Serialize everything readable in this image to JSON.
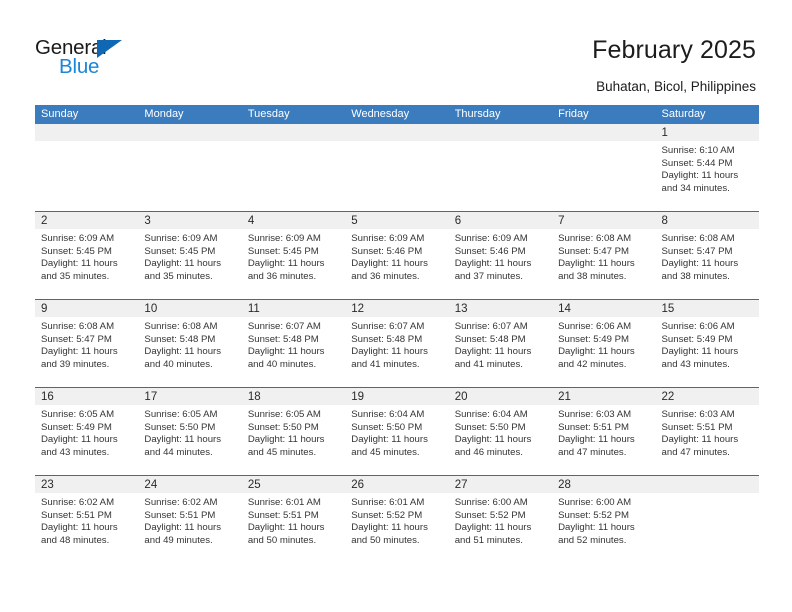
{
  "logo": {
    "word_one": "General",
    "word_two": "Blue",
    "triangle_color": "#1068b5",
    "blue_color": "#1a86d8"
  },
  "header": {
    "title": "February 2025",
    "subtitle": "Buhatan, Bicol, Philippines"
  },
  "theme": {
    "header_bg": "#3a7cbe",
    "header_text": "#ffffff",
    "row_divider": "#2f6fac",
    "daynum_band": "#f0f0f0",
    "body_text": "#343434"
  },
  "weekdays": [
    "Sunday",
    "Monday",
    "Tuesday",
    "Wednesday",
    "Thursday",
    "Friday",
    "Saturday"
  ],
  "weeks": [
    [
      {
        "day": "",
        "sunrise": "",
        "sunset": "",
        "daylight": ""
      },
      {
        "day": "",
        "sunrise": "",
        "sunset": "",
        "daylight": ""
      },
      {
        "day": "",
        "sunrise": "",
        "sunset": "",
        "daylight": ""
      },
      {
        "day": "",
        "sunrise": "",
        "sunset": "",
        "daylight": ""
      },
      {
        "day": "",
        "sunrise": "",
        "sunset": "",
        "daylight": ""
      },
      {
        "day": "",
        "sunrise": "",
        "sunset": "",
        "daylight": ""
      },
      {
        "day": "1",
        "sunrise": "Sunrise: 6:10 AM",
        "sunset": "Sunset: 5:44 PM",
        "daylight": "Daylight: 11 hours and 34 minutes."
      }
    ],
    [
      {
        "day": "2",
        "sunrise": "Sunrise: 6:09 AM",
        "sunset": "Sunset: 5:45 PM",
        "daylight": "Daylight: 11 hours and 35 minutes."
      },
      {
        "day": "3",
        "sunrise": "Sunrise: 6:09 AM",
        "sunset": "Sunset: 5:45 PM",
        "daylight": "Daylight: 11 hours and 35 minutes."
      },
      {
        "day": "4",
        "sunrise": "Sunrise: 6:09 AM",
        "sunset": "Sunset: 5:45 PM",
        "daylight": "Daylight: 11 hours and 36 minutes."
      },
      {
        "day": "5",
        "sunrise": "Sunrise: 6:09 AM",
        "sunset": "Sunset: 5:46 PM",
        "daylight": "Daylight: 11 hours and 36 minutes."
      },
      {
        "day": "6",
        "sunrise": "Sunrise: 6:09 AM",
        "sunset": "Sunset: 5:46 PM",
        "daylight": "Daylight: 11 hours and 37 minutes."
      },
      {
        "day": "7",
        "sunrise": "Sunrise: 6:08 AM",
        "sunset": "Sunset: 5:47 PM",
        "daylight": "Daylight: 11 hours and 38 minutes."
      },
      {
        "day": "8",
        "sunrise": "Sunrise: 6:08 AM",
        "sunset": "Sunset: 5:47 PM",
        "daylight": "Daylight: 11 hours and 38 minutes."
      }
    ],
    [
      {
        "day": "9",
        "sunrise": "Sunrise: 6:08 AM",
        "sunset": "Sunset: 5:47 PM",
        "daylight": "Daylight: 11 hours and 39 minutes."
      },
      {
        "day": "10",
        "sunrise": "Sunrise: 6:08 AM",
        "sunset": "Sunset: 5:48 PM",
        "daylight": "Daylight: 11 hours and 40 minutes."
      },
      {
        "day": "11",
        "sunrise": "Sunrise: 6:07 AM",
        "sunset": "Sunset: 5:48 PM",
        "daylight": "Daylight: 11 hours and 40 minutes."
      },
      {
        "day": "12",
        "sunrise": "Sunrise: 6:07 AM",
        "sunset": "Sunset: 5:48 PM",
        "daylight": "Daylight: 11 hours and 41 minutes."
      },
      {
        "day": "13",
        "sunrise": "Sunrise: 6:07 AM",
        "sunset": "Sunset: 5:48 PM",
        "daylight": "Daylight: 11 hours and 41 minutes."
      },
      {
        "day": "14",
        "sunrise": "Sunrise: 6:06 AM",
        "sunset": "Sunset: 5:49 PM",
        "daylight": "Daylight: 11 hours and 42 minutes."
      },
      {
        "day": "15",
        "sunrise": "Sunrise: 6:06 AM",
        "sunset": "Sunset: 5:49 PM",
        "daylight": "Daylight: 11 hours and 43 minutes."
      }
    ],
    [
      {
        "day": "16",
        "sunrise": "Sunrise: 6:05 AM",
        "sunset": "Sunset: 5:49 PM",
        "daylight": "Daylight: 11 hours and 43 minutes."
      },
      {
        "day": "17",
        "sunrise": "Sunrise: 6:05 AM",
        "sunset": "Sunset: 5:50 PM",
        "daylight": "Daylight: 11 hours and 44 minutes."
      },
      {
        "day": "18",
        "sunrise": "Sunrise: 6:05 AM",
        "sunset": "Sunset: 5:50 PM",
        "daylight": "Daylight: 11 hours and 45 minutes."
      },
      {
        "day": "19",
        "sunrise": "Sunrise: 6:04 AM",
        "sunset": "Sunset: 5:50 PM",
        "daylight": "Daylight: 11 hours and 45 minutes."
      },
      {
        "day": "20",
        "sunrise": "Sunrise: 6:04 AM",
        "sunset": "Sunset: 5:50 PM",
        "daylight": "Daylight: 11 hours and 46 minutes."
      },
      {
        "day": "21",
        "sunrise": "Sunrise: 6:03 AM",
        "sunset": "Sunset: 5:51 PM",
        "daylight": "Daylight: 11 hours and 47 minutes."
      },
      {
        "day": "22",
        "sunrise": "Sunrise: 6:03 AM",
        "sunset": "Sunset: 5:51 PM",
        "daylight": "Daylight: 11 hours and 47 minutes."
      }
    ],
    [
      {
        "day": "23",
        "sunrise": "Sunrise: 6:02 AM",
        "sunset": "Sunset: 5:51 PM",
        "daylight": "Daylight: 11 hours and 48 minutes."
      },
      {
        "day": "24",
        "sunrise": "Sunrise: 6:02 AM",
        "sunset": "Sunset: 5:51 PM",
        "daylight": "Daylight: 11 hours and 49 minutes."
      },
      {
        "day": "25",
        "sunrise": "Sunrise: 6:01 AM",
        "sunset": "Sunset: 5:51 PM",
        "daylight": "Daylight: 11 hours and 50 minutes."
      },
      {
        "day": "26",
        "sunrise": "Sunrise: 6:01 AM",
        "sunset": "Sunset: 5:52 PM",
        "daylight": "Daylight: 11 hours and 50 minutes."
      },
      {
        "day": "27",
        "sunrise": "Sunrise: 6:00 AM",
        "sunset": "Sunset: 5:52 PM",
        "daylight": "Daylight: 11 hours and 51 minutes."
      },
      {
        "day": "28",
        "sunrise": "Sunrise: 6:00 AM",
        "sunset": "Sunset: 5:52 PM",
        "daylight": "Daylight: 11 hours and 52 minutes."
      },
      {
        "day": "",
        "sunrise": "",
        "sunset": "",
        "daylight": ""
      }
    ]
  ]
}
